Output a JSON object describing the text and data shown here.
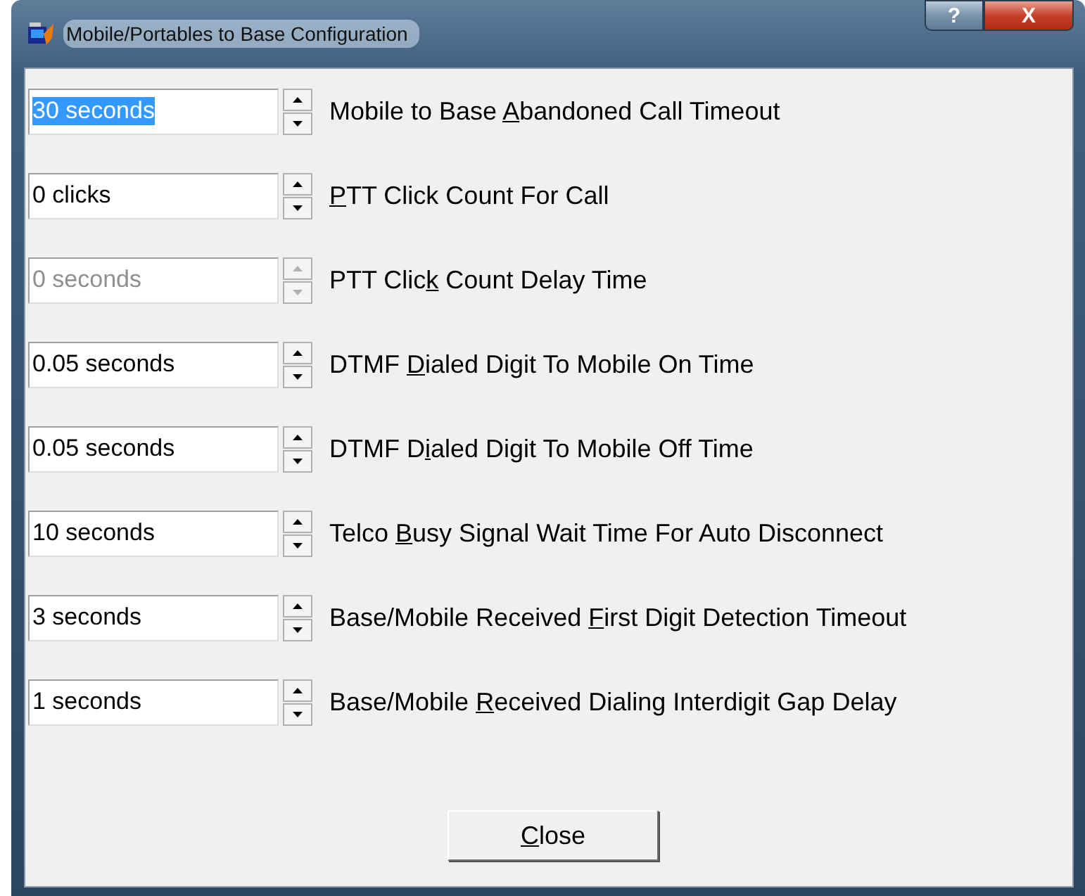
{
  "window": {
    "title": "Mobile/Portables to Base Configuration",
    "help_button": "?",
    "close_button": "X"
  },
  "settings": [
    {
      "value": "30 seconds",
      "selected": true,
      "disabled": false,
      "label_before": "Mobile to Base ",
      "access_key": "A",
      "label_after": "bandoned Call Timeout"
    },
    {
      "value": "0 clicks",
      "selected": false,
      "disabled": false,
      "access_key": "P",
      "label_after": "TT Click Count For Call"
    },
    {
      "value": "0 seconds",
      "selected": false,
      "disabled": true,
      "label_before": "PTT Clic",
      "access_key": "k",
      "label_after": " Count Delay Time"
    },
    {
      "value": "0.05 seconds",
      "selected": false,
      "disabled": false,
      "label_before": "DTMF ",
      "access_key": "D",
      "label_after": "ialed Digit To Mobile On Time"
    },
    {
      "value": "0.05 seconds",
      "selected": false,
      "disabled": false,
      "label_before": "DTMF D",
      "access_key": "i",
      "label_after": "aled Digit To Mobile Off Time"
    },
    {
      "value": "10 seconds",
      "selected": false,
      "disabled": false,
      "label_before": "Telco ",
      "access_key": "B",
      "label_after": "usy Signal Wait Time For Auto Disconnect"
    },
    {
      "value": "3 seconds",
      "selected": false,
      "disabled": false,
      "label_before": "Base/Mobile Received ",
      "access_key": "F",
      "label_after": "irst Digit Detection Timeout"
    },
    {
      "value": "1 seconds",
      "selected": false,
      "disabled": false,
      "label_before": "Base/Mobile ",
      "access_key": "R",
      "label_after": "eceived Dialing Interdigit Gap Delay"
    }
  ],
  "close_button": {
    "access_key": "C",
    "label_after": "lose"
  }
}
